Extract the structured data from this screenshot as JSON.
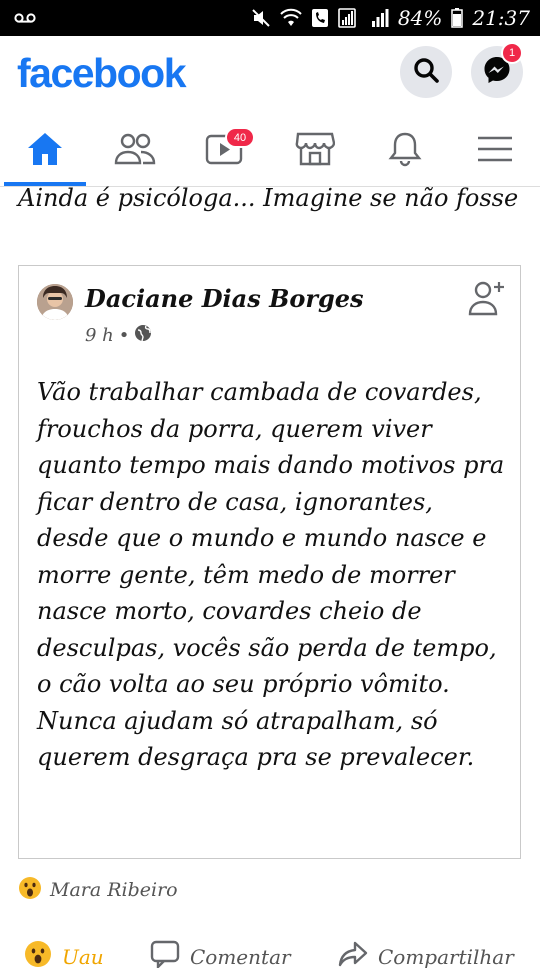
{
  "status_bar": {
    "battery": "84%",
    "time": "21:37"
  },
  "header": {
    "logo": "facebook",
    "search_icon": "search-icon",
    "messenger_icon": "messenger-icon",
    "messenger_badge": "1"
  },
  "nav": {
    "tabs": [
      {
        "name": "home",
        "icon": "home-icon",
        "active": true
      },
      {
        "name": "friends",
        "icon": "friends-icon"
      },
      {
        "name": "watch",
        "icon": "video-icon",
        "badge": "40"
      },
      {
        "name": "marketplace",
        "icon": "marketplace-icon"
      },
      {
        "name": "notifications",
        "icon": "bell-icon"
      },
      {
        "name": "menu",
        "icon": "hamburger-icon"
      }
    ],
    "accent": "#1877f2"
  },
  "post": {
    "caption": "Ainda é psicóloga... Imagine se não fosse",
    "shared": {
      "author": "Daciane Dias Borges",
      "time": "9 h",
      "text": "Vão trabalhar cambada de covardes, frouchos da porra, querem viver quanto tempo mais dando motivos pra ficar dentro de casa, ignorantes, desde que o mundo e mundo nasce e morre gente, têm medo de morrer nasce morto, covardes cheio de desculpas, vocês são perda de tempo, o cão volta ao seu próprio vômito. Nunca ajudam só atrapalham, só querem desgraça pra se prevalecer."
    },
    "reaction_by": "Mara Ribeiro",
    "actions": {
      "like": "Uau",
      "comment": "Comentar",
      "share": "Compartilhar"
    }
  }
}
